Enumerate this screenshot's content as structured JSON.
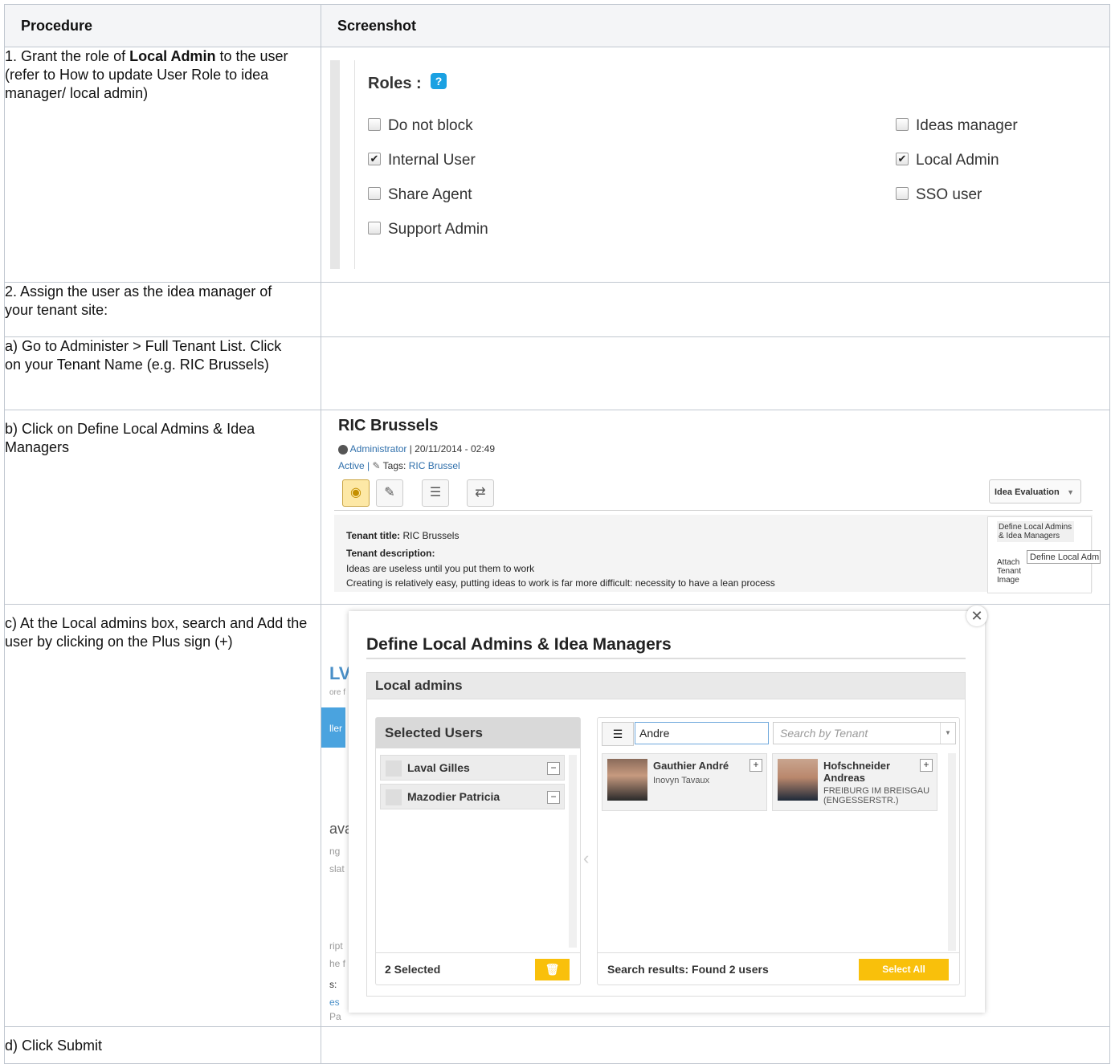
{
  "headers": {
    "procedure": "Procedure",
    "screenshot": "Screenshot"
  },
  "steps": {
    "s1": {
      "prefix": "1. Grant the role of ",
      "bold": "Local  Admin",
      "suffix": " to the user (refer to How to update User Role to idea manager/ local admin)"
    },
    "s2": "2. Assign the user as the idea manager of your tenant site:",
    "s3": "a) Go to Administer > Full Tenant List. Click on your Tenant Name (e.g. RIC Brussels)",
    "s4": "b) Click on Define Local Admins & Idea Managers",
    "s5": "c) At the Local admins box, search and Add the user by clicking on the Plus sign (+)",
    "s6": "d) Click Submit"
  },
  "roles": {
    "title": "Roles :",
    "help_icon": "question-icon",
    "left": [
      {
        "label": "Do not block",
        "checked": false
      },
      {
        "label": "Internal User",
        "checked": true
      },
      {
        "label": "Share Agent",
        "checked": false
      },
      {
        "label": "Support Admin",
        "checked": false
      }
    ],
    "right": [
      {
        "label": "Ideas manager",
        "checked": false
      },
      {
        "label": "Local Admin",
        "checked": true
      },
      {
        "label": "SSO user",
        "checked": false
      }
    ]
  },
  "ric": {
    "title": "RIC Brussels",
    "author": "Administrator",
    "date": "| 20/11/2014 - 02:49",
    "status": "Active |",
    "tags_label": "Tags:",
    "tags_value": "RIC Brussel",
    "dropdown": "Idea Evaluation",
    "tenant_title_label": "Tenant title:",
    "tenant_title_value": "RIC Brussels",
    "tenant_desc_label": "Tenant description:",
    "desc_line1": "Ideas are useless until you put them to work",
    "desc_line2": "Creating is relatively easy, putting ideas to work is far more difficult: necessity to have a lean process",
    "menu_item1": "Define Local Admins & Idea Managers",
    "menu_item2": "Attach Tenant Image",
    "tooltip": "Define Local Adm"
  },
  "modal": {
    "title": "Define Local Admins & Idea Managers",
    "section": "Local admins",
    "selected_header": "Selected Users",
    "selected_users": [
      "Laval Gilles",
      "Mazodier Patricia"
    ],
    "selected_count": "2 Selected",
    "search_value": "Andre",
    "tenant_placeholder": "Search by Tenant",
    "results": [
      {
        "name": "Gauthier André",
        "org": "Inovyn Tavaux"
      },
      {
        "name": "Hofschneider Andreas",
        "org": "FREIBURG IM BREISGAU (ENGESSERSTR.)"
      }
    ],
    "results_footer": "Search results: Found 2 users",
    "select_all": "Select All"
  },
  "bg_fragments": [
    "ore f",
    "ller",
    "ava",
    "ng",
    "slat",
    "ript",
    "he f",
    "s:",
    "es",
    "Pa"
  ]
}
